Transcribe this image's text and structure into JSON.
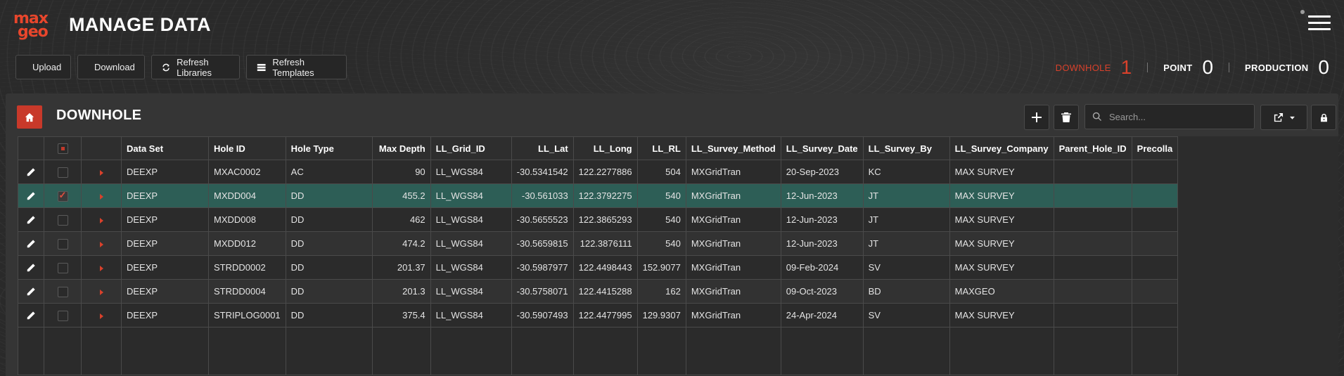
{
  "header": {
    "logo_line1": "max",
    "logo_line2": "geo",
    "title": "MANAGE DATA"
  },
  "toolbar": {
    "upload_label": "Upload",
    "download_label": "Download",
    "refresh_libraries_label": "Refresh Libraries",
    "refresh_templates_label": "Refresh Templates"
  },
  "counters": {
    "downhole_label": "DOWNHOLE",
    "downhole_value": "1",
    "point_label": "POINT",
    "point_value": "0",
    "production_label": "PRODUCTION",
    "production_value": "0",
    "active_color": "#d9412b"
  },
  "panel": {
    "title": "DOWNHOLE",
    "search_placeholder": "Search...",
    "selected_row_color": "#2d5e56"
  },
  "table": {
    "columns": {
      "data_set": "Data Set",
      "hole_id": "Hole ID",
      "hole_type": "Hole Type",
      "max_depth": "Max Depth",
      "ll_grid_id": "LL_Grid_ID",
      "ll_lat": "LL_Lat",
      "ll_long": "LL_Long",
      "ll_rl": "LL_RL",
      "ll_survey_method": "LL_Survey_Method",
      "ll_survey_date": "LL_Survey_Date",
      "ll_survey_by": "LL_Survey_By",
      "ll_survey_company": "LL_Survey_Company",
      "parent_hole_id": "Parent_Hole_ID",
      "precollar": "Precolla"
    },
    "rows": [
      {
        "data_set": "DEEXP",
        "hole_id": "MXAC0002",
        "hole_type": "AC",
        "max_depth": "90",
        "ll_grid_id": "LL_WGS84",
        "ll_lat": "-30.5341542",
        "ll_long": "122.2277886",
        "ll_rl": "504",
        "ll_survey_method": "MXGridTran",
        "ll_survey_date": "20-Sep-2023",
        "ll_survey_by": "KC",
        "ll_survey_company": "MAX SURVEY",
        "parent_hole_id": "",
        "precollar": "",
        "checked": false
      },
      {
        "data_set": "DEEXP",
        "hole_id": "MXDD004",
        "hole_type": "DD",
        "max_depth": "455.2",
        "ll_grid_id": "LL_WGS84",
        "ll_lat": "-30.561033",
        "ll_long": "122.3792275",
        "ll_rl": "540",
        "ll_survey_method": "MXGridTran",
        "ll_survey_date": "12-Jun-2023",
        "ll_survey_by": "JT",
        "ll_survey_company": "MAX SURVEY",
        "parent_hole_id": "",
        "precollar": "",
        "checked": true
      },
      {
        "data_set": "DEEXP",
        "hole_id": "MXDD008",
        "hole_type": "DD",
        "max_depth": "462",
        "ll_grid_id": "LL_WGS84",
        "ll_lat": "-30.5655523",
        "ll_long": "122.3865293",
        "ll_rl": "540",
        "ll_survey_method": "MXGridTran",
        "ll_survey_date": "12-Jun-2023",
        "ll_survey_by": "JT",
        "ll_survey_company": "MAX SURVEY",
        "parent_hole_id": "",
        "precollar": "",
        "checked": false
      },
      {
        "data_set": "DEEXP",
        "hole_id": "MXDD012",
        "hole_type": "DD",
        "max_depth": "474.2",
        "ll_grid_id": "LL_WGS84",
        "ll_lat": "-30.5659815",
        "ll_long": "122.3876111",
        "ll_rl": "540",
        "ll_survey_method": "MXGridTran",
        "ll_survey_date": "12-Jun-2023",
        "ll_survey_by": "JT",
        "ll_survey_company": "MAX SURVEY",
        "parent_hole_id": "",
        "precollar": "",
        "checked": false
      },
      {
        "data_set": "DEEXP",
        "hole_id": "STRDD0002",
        "hole_type": "DD",
        "max_depth": "201.37",
        "ll_grid_id": "LL_WGS84",
        "ll_lat": "-30.5987977",
        "ll_long": "122.4498443",
        "ll_rl": "152.9077",
        "ll_survey_method": "MXGridTran",
        "ll_survey_date": "09-Feb-2024",
        "ll_survey_by": "SV",
        "ll_survey_company": "MAX SURVEY",
        "parent_hole_id": "",
        "precollar": "",
        "checked": false
      },
      {
        "data_set": "DEEXP",
        "hole_id": "STRDD0004",
        "hole_type": "DD",
        "max_depth": "201.3",
        "ll_grid_id": "LL_WGS84",
        "ll_lat": "-30.5758071",
        "ll_long": "122.4415288",
        "ll_rl": "162",
        "ll_survey_method": "MXGridTran",
        "ll_survey_date": "09-Oct-2023",
        "ll_survey_by": "BD",
        "ll_survey_company": "MAXGEO",
        "parent_hole_id": "",
        "precollar": "",
        "checked": false
      },
      {
        "data_set": "DEEXP",
        "hole_id": "STRIPLOG0001",
        "hole_type": "DD",
        "max_depth": "375.4",
        "ll_grid_id": "LL_WGS84",
        "ll_lat": "-30.5907493",
        "ll_long": "122.4477995",
        "ll_rl": "129.9307",
        "ll_survey_method": "MXGridTran",
        "ll_survey_date": "24-Apr-2024",
        "ll_survey_by": "SV",
        "ll_survey_company": "MAX SURVEY",
        "parent_hole_id": "",
        "precollar": "",
        "checked": false
      }
    ]
  }
}
